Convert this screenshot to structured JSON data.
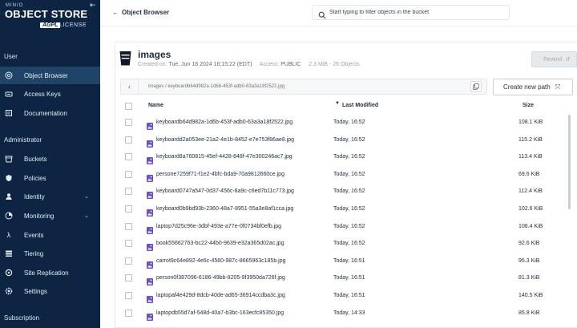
{
  "sidebar": {
    "logo": {
      "mini": "MINIO",
      "brand": "OBJECT STORE",
      "badge": "AGPL",
      "license": "LICENSE"
    },
    "sections": {
      "user": "User",
      "administrator": "Administrator",
      "subscription": "Subscription"
    },
    "user_items": [
      {
        "label": "Object Browser",
        "icon": "folder-search-icon"
      },
      {
        "label": "Access Keys",
        "icon": "key-icon"
      },
      {
        "label": "Documentation",
        "icon": "book-icon"
      }
    ],
    "admin_items": [
      {
        "label": "Buckets",
        "icon": "bucket-icon"
      },
      {
        "label": "Policies",
        "icon": "shield-icon"
      },
      {
        "label": "Identity",
        "icon": "identity-icon"
      },
      {
        "label": "Monitoring",
        "icon": "monitoring-icon"
      },
      {
        "label": "Events",
        "icon": "lambda-icon"
      },
      {
        "label": "Tiering",
        "icon": "tiering-icon"
      },
      {
        "label": "Site Replication",
        "icon": "replication-icon"
      },
      {
        "label": "Settings",
        "icon": "gear-icon"
      }
    ]
  },
  "header": {
    "title": "Object Browser",
    "search_placeholder": "Start typing to filter objects in the bucket"
  },
  "bucket": {
    "name": "images",
    "created_label": "Created on:",
    "created_value": "Tue, Jun 18 2024 16:15:22 (EDT)",
    "access_label": "Access:",
    "access_value": "PUBLIC",
    "stats": "2.3 MiB - 26 Objects",
    "rewind_label": "Rewind"
  },
  "path": {
    "text": "images / keyboardb64d982a-1d6b-453f-adb0-63a3a18f2522.jpg",
    "new_path_label": "Create new path"
  },
  "table": {
    "headers": {
      "name": "Name",
      "modified": "Last Modified",
      "size": "Size"
    },
    "rows": [
      {
        "name": "keyboardb64d982a-1d6b-453f-adb0-63a3a18f2522.jpg",
        "modified": "Today, 16:52",
        "size": "108.1 KiB"
      },
      {
        "name": "keyboardd2a053ee-21a2-4e1b-8452-e7e753f86ae8.jpg",
        "modified": "Today, 16:52",
        "size": "115.2 KiB"
      },
      {
        "name": "keyboard8a760815-45ef-4428-848f-47e300246ac7.jpg",
        "modified": "Today, 16:52",
        "size": "113.4 KiB"
      },
      {
        "name": "persone7259f71-f1e2-4bfc-bda9-70a9812660ce.jpg",
        "modified": "Today, 16:52",
        "size": "69.6 KiB"
      },
      {
        "name": "keyboard0747a547-0d37-456c-8a9c-c6ed7b11c773.jpg",
        "modified": "Today, 16:52",
        "size": "112.4 KiB"
      },
      {
        "name": "keyboard0b9bd93b-2360-48a7-8951-55a3e8af1cca.jpg",
        "modified": "Today, 16:52",
        "size": "102.6 KiB"
      },
      {
        "name": "laptop7d25c96e-3dbf-493e-a77e-0f0734bf0efb.jpg",
        "modified": "Today, 16:52",
        "size": "106.4 KiB"
      },
      {
        "name": "book55662763-bc22-44b0-9639-e32a365d02ac.jpg",
        "modified": "Today, 16:52",
        "size": "92.6 KiB"
      },
      {
        "name": "carrot9c64e892-4e6c-4560-987c-8665963c185b.jpg",
        "modified": "Today, 16:51",
        "size": "95.3 KiB"
      },
      {
        "name": "person0f387096-6186-49bb-8205-9f3950da726f.jpg",
        "modified": "Today, 16:51",
        "size": "81.3 KiB"
      },
      {
        "name": "laptopaf4e429d-8dcb-40de-ad65-36914ccdba3c.jpg",
        "modified": "Today, 16:51",
        "size": "140.5 KiB"
      },
      {
        "name": "laptopdb55d7af-548d-40a7-b3bc-163ecfc85350.jpg",
        "modified": "Today, 14:33",
        "size": "85.8 KiB"
      }
    ]
  },
  "colors": {
    "sidebar_bg": "#0d2542",
    "sidebar_active": "#1f4468",
    "file_icon": "#6d4fc6"
  }
}
